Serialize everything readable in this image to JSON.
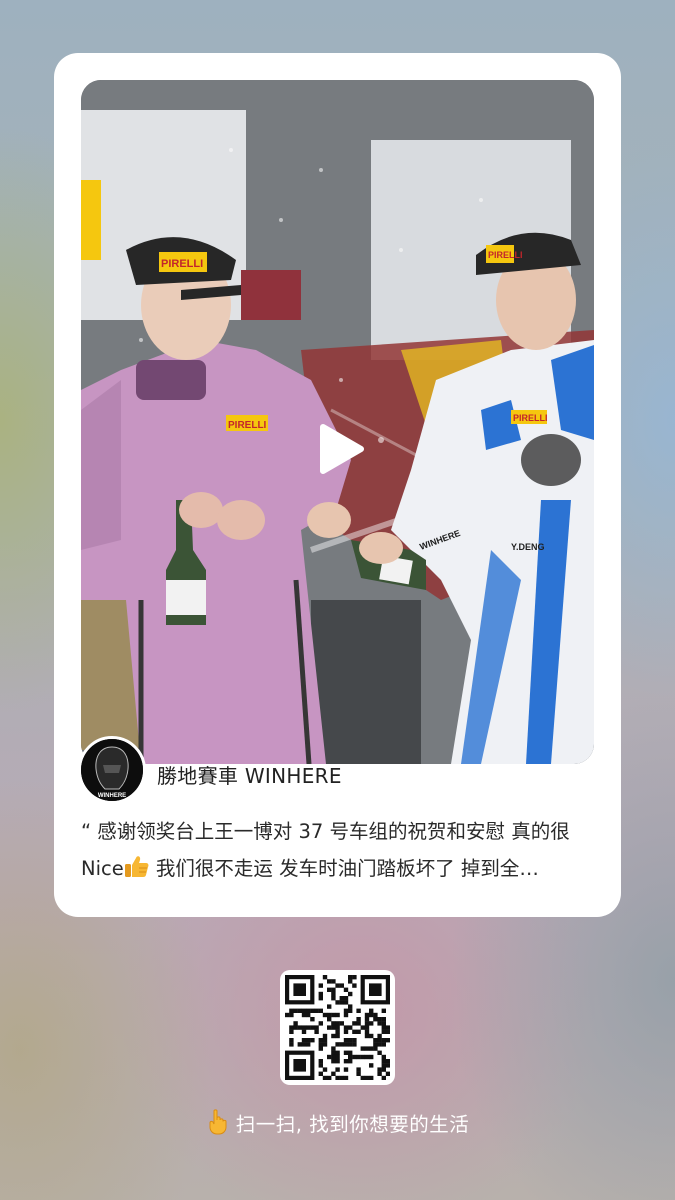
{
  "post": {
    "video_thumbnail": "podium champagne celebration photo",
    "play_icon": "play-icon",
    "author": {
      "name": "勝地賽車 WINHERE",
      "avatar_text": "WINHERE"
    },
    "caption_line1": "“ 感谢领奖台上王一博对 37 号车组的祝贺和安慰 真的很",
    "caption_line2_prefix": "Nice",
    "caption_line2_rest": " 我们很不走运 发车时油门踏板坏了 掉到全…",
    "caption_emoji": "thumbs-up-icon"
  },
  "footer": {
    "qr_icon": "qr-code",
    "cta_hand_icon": "pointing-hand-icon",
    "cta_text": "扫一扫, 找到你想要的生活"
  },
  "photo_text": {
    "cap_left": "PIRELLI",
    "cap_right": "PIRELLI",
    "suit_left": "PIRELLI",
    "suit_right": "PIRELLI",
    "suit_right_name": "Y.DENG",
    "suit_right_team": "WINHERE"
  },
  "colors": {
    "pink_suit": "#c48fbf",
    "blue_suit": "#1f6bd1",
    "pirelli_yellow": "#f5c400",
    "card_bg": "#ffffff"
  }
}
